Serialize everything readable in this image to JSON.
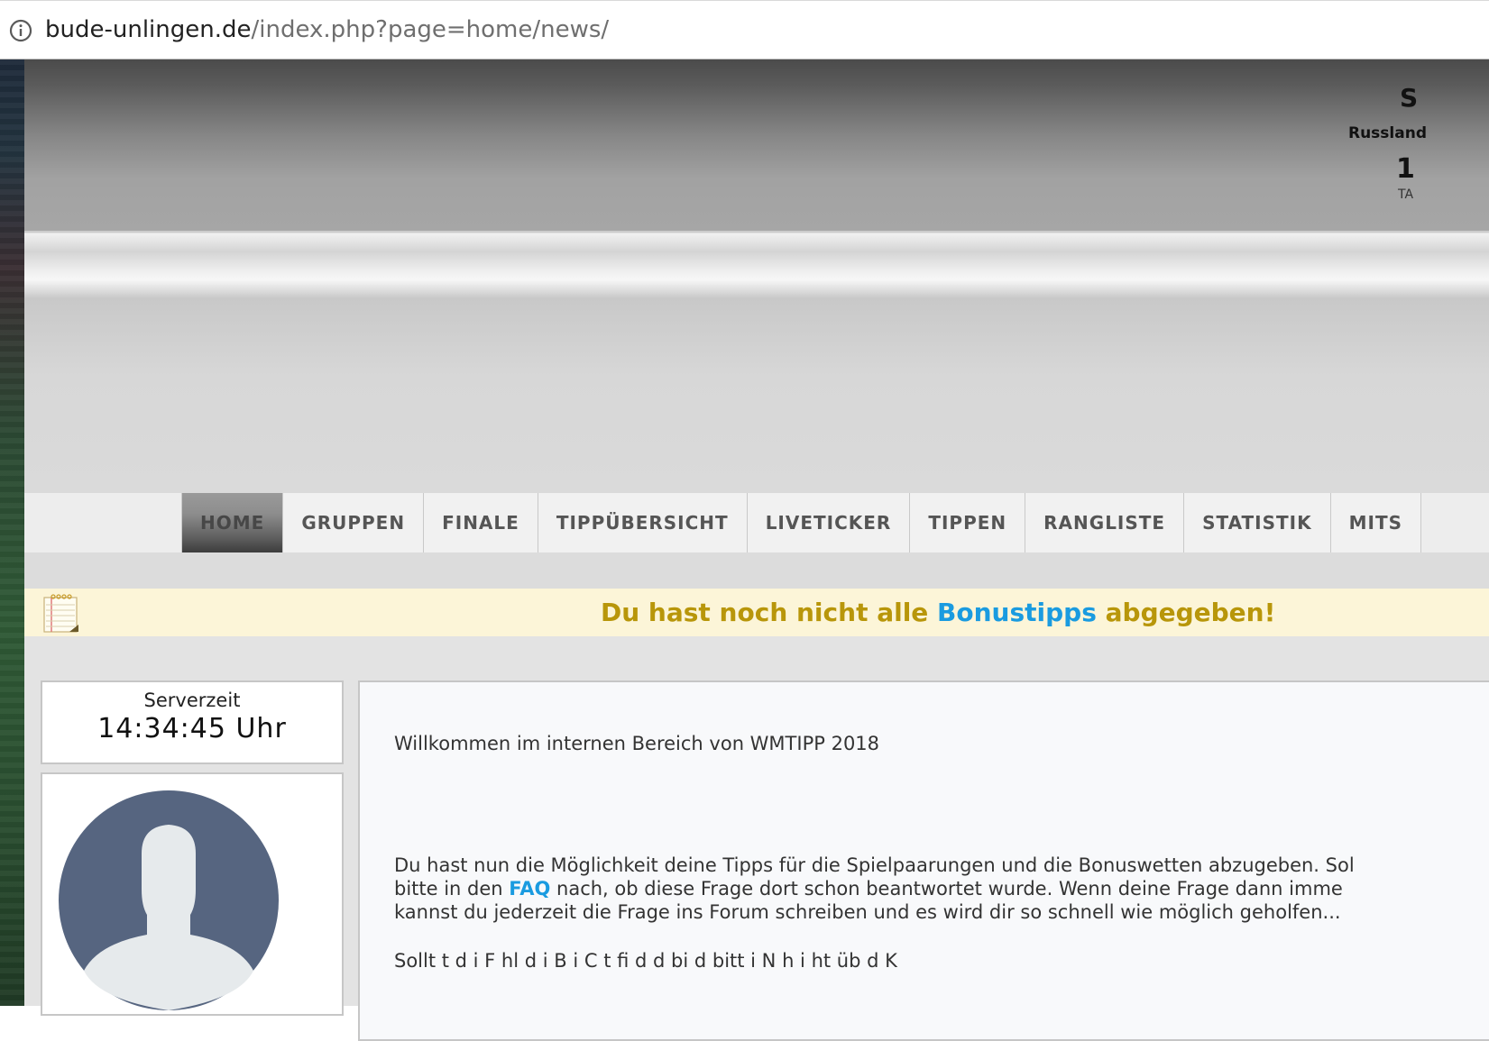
{
  "browser": {
    "url_domain": "bude-unlingen.de",
    "url_path": "/index.php?page=home/news/"
  },
  "header": {
    "countdown_title_partial": "S",
    "countdown_location": "Russland",
    "countdown_number_partial": "1",
    "countdown_unit_partial": "TA"
  },
  "nav": {
    "items": [
      {
        "label": "HOME",
        "active": true
      },
      {
        "label": "GRUPPEN"
      },
      {
        "label": "FINALE"
      },
      {
        "label": "TIPPÜBERSICHT"
      },
      {
        "label": "LIVETICKER"
      },
      {
        "label": "TIPPEN"
      },
      {
        "label": "RANGLISTE"
      },
      {
        "label": "STATISTIK"
      },
      {
        "label": "MITS"
      }
    ]
  },
  "notice": {
    "text_before": "Du hast noch nicht alle ",
    "link": "Bonustipps",
    "text_after": " abgegeben!",
    "text_color": "#b8960a",
    "link_color": "#1a9be0"
  },
  "sidebar": {
    "server_label": "Serverzeit",
    "server_time": "14:34:45 Uhr"
  },
  "main": {
    "welcome": "Willkommen im internen Bereich von WMTIPP 2018",
    "paragraph_line1": "Du hast nun die Möglichkeit deine Tipps für die Spielpaarungen und die Bonuswetten abzugeben. Sol",
    "paragraph_line2_before": "bitte in den ",
    "paragraph_line2_link": "FAQ",
    "paragraph_line2_after": " nach, ob diese Frage dort schon beantwortet wurde. Wenn deine Frage dann imme",
    "paragraph_line3": "kannst du jederzeit die Frage ins Forum schreiben und es wird dir so schnell wie möglich geholfen...",
    "paragraph2_partial": "Sollt t d i F hl d i B i C t fi d d bi d bitt i N h i ht üb d K"
  }
}
